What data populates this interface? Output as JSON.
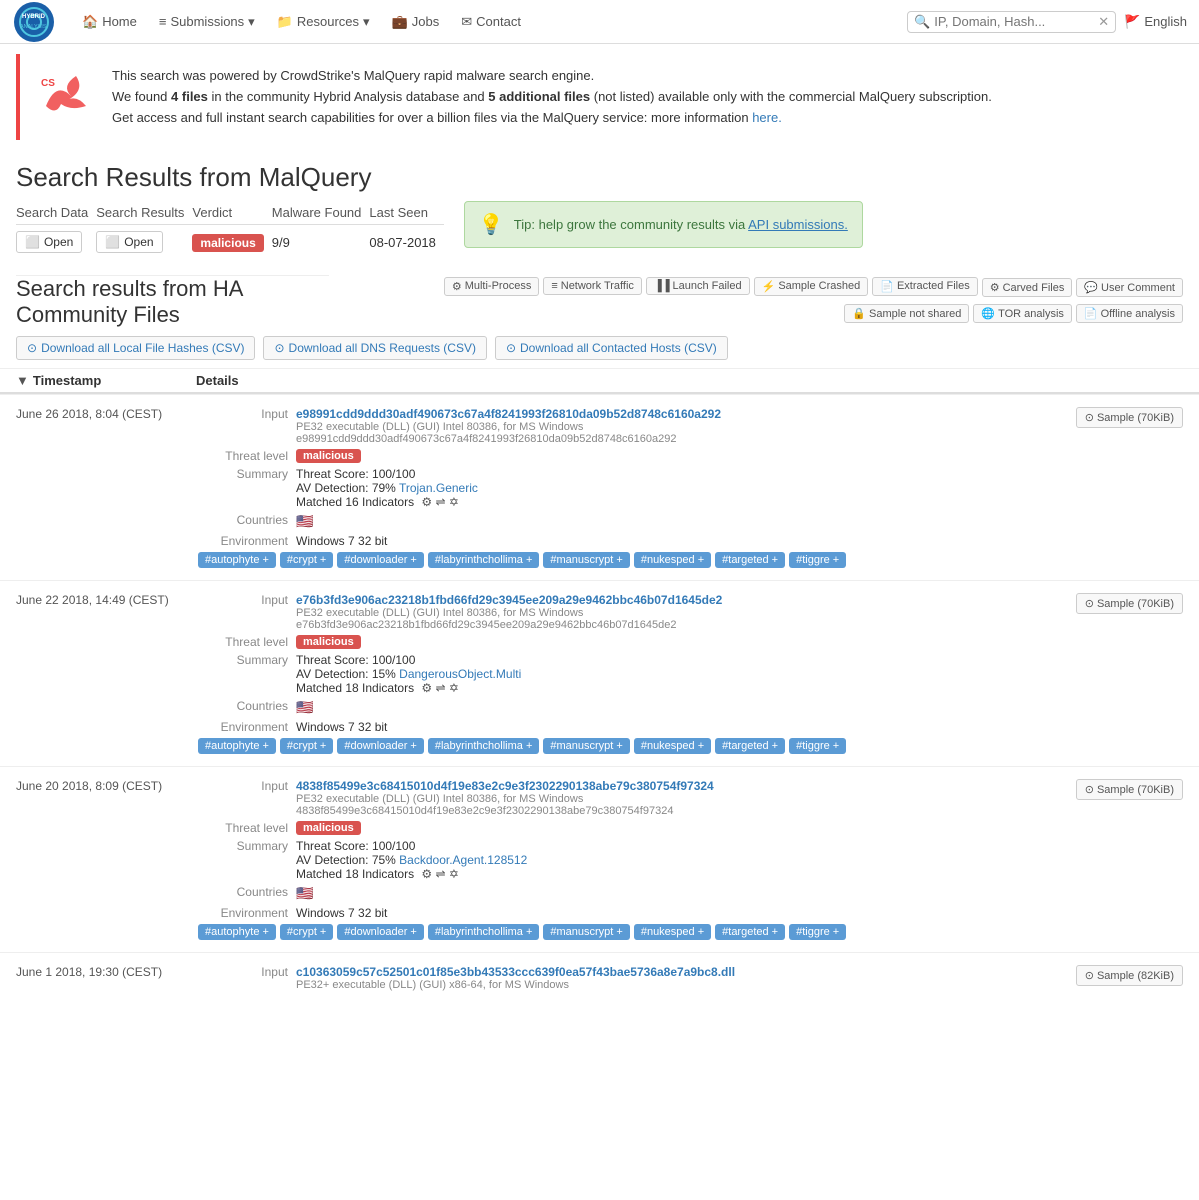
{
  "brand": {
    "name": "HYBRID ANALYSIS",
    "logo_text": "HA"
  },
  "nav": {
    "home": "Home",
    "submissions": "Submissions",
    "resources": "Resources",
    "jobs": "Jobs",
    "contact": "Contact",
    "search_placeholder": "IP, Domain, Hash...",
    "language": "English"
  },
  "banner": {
    "text1": "This search was powered by CrowdStrike's MalQuery rapid malware search engine.",
    "text2_pre": "We found ",
    "text2_bold1": "4 files",
    "text2_mid": " in the community Hybrid Analysis database and ",
    "text2_bold2": "5 additional files",
    "text2_post": " (not listed) available only with the commercial MalQuery subscription.",
    "text3_pre": "Get access and full instant search capabilities for over a billion files via the MalQuery service: more information ",
    "text3_link": "here.",
    "link_url": "#"
  },
  "page_title": "Search Results from MalQuery",
  "search_table": {
    "columns": [
      "Search Data",
      "Search Results",
      "Verdict",
      "Malware Found",
      "Last Seen"
    ],
    "row": {
      "search_data_label": "Open",
      "search_results_label": "Open",
      "verdict": "malicious",
      "malware_found": "9/9",
      "last_seen": "08-07-2018"
    }
  },
  "tip": {
    "text": "Tip: help grow the community results via ",
    "link_text": "API submissions.",
    "link_url": "#"
  },
  "community_title": "Search results from HA Community Files",
  "filter_buttons": [
    {
      "label": "Multi-Process",
      "icon": "⚙"
    },
    {
      "label": "Network Traffic",
      "icon": "≡"
    },
    {
      "label": "Launch Failed",
      "icon": "▐▐"
    },
    {
      "label": "Sample Crashed",
      "icon": "⚡"
    },
    {
      "label": "Extracted Files",
      "icon": "📄"
    },
    {
      "label": "Carved Files",
      "icon": "⚙"
    },
    {
      "label": "User Comment",
      "icon": "💬"
    },
    {
      "label": "Sample not shared",
      "icon": "🔒"
    },
    {
      "label": "TOR analysis",
      "icon": "🌐"
    },
    {
      "label": "Offline analysis",
      "icon": "📄"
    }
  ],
  "download_buttons": [
    {
      "label": "Download all Local File Hashes (CSV)",
      "icon": "⊙"
    },
    {
      "label": "Download all DNS Requests (CSV)",
      "icon": "⊙"
    },
    {
      "label": "Download all Contacted Hosts (CSV)",
      "icon": "⊙"
    }
  ],
  "table_columns": [
    "Timestamp",
    "Details"
  ],
  "results": [
    {
      "timestamp": "June 26 2018, 8:04 (CEST)",
      "input_hash": "e98991cdd9ddd30adf490673c67a4f8241993f26810da09b52d8748c6160a292",
      "input_type": "PE32 executable (DLL) (GUI) Intel 80386, for MS Windows",
      "input_hash2": "e98991cdd9ddd30adf490673c67a4f8241993f26810da09b52d8748c6160a292",
      "threat_level": "malicious",
      "threat_score": "Threat Score: 100/100",
      "av_detection": "AV Detection: 79%",
      "av_name": "Trojan.Generic",
      "matched": "Matched 16 Indicators",
      "countries": "🇺🇸",
      "environment": "Windows 7 32 bit",
      "tags": [
        "#autophyte +",
        "#crypt +",
        "#downloader +",
        "#labyrinthchollima +",
        "#manuscrypt +",
        "#nukesped +",
        "#targeted +",
        "#tiggre +"
      ],
      "sample_label": "Sample (70KiB)"
    },
    {
      "timestamp": "June 22 2018, 14:49 (CEST)",
      "input_hash": "e76b3fd3e906ac23218b1fbd66fd29c3945ee209a29e9462bbc46b07d1645de2",
      "input_type": "PE32 executable (DLL) (GUI) Intel 80386, for MS Windows",
      "input_hash2": "e76b3fd3e906ac23218b1fbd66fd29c3945ee209a29e9462bbc46b07d1645de2",
      "threat_level": "malicious",
      "threat_score": "Threat Score: 100/100",
      "av_detection": "AV Detection: 15%",
      "av_name": "DangerousObject.Multi",
      "matched": "Matched 18 Indicators",
      "countries": "🇺🇸",
      "environment": "Windows 7 32 bit",
      "tags": [
        "#autophyte +",
        "#crypt +",
        "#downloader +",
        "#labyrinthchollima +",
        "#manuscrypt +",
        "#nukesped +",
        "#targeted +",
        "#tiggre +"
      ],
      "sample_label": "Sample (70KiB)"
    },
    {
      "timestamp": "June 20 2018, 8:09 (CEST)",
      "input_hash": "4838f85499e3c68415010d4f19e83e2c9e3f2302290138abe79c380754f97324",
      "input_type": "PE32 executable (DLL) (GUI) Intel 80386, for MS Windows",
      "input_hash2": "4838f85499e3c68415010d4f19e83e2c9e3f2302290138abe79c380754f97324",
      "threat_level": "malicious",
      "threat_score": "Threat Score: 100/100",
      "av_detection": "AV Detection: 75%",
      "av_name": "Backdoor.Agent.128512",
      "matched": "Matched 18 Indicators",
      "countries": "🇺🇸",
      "environment": "Windows 7 32 bit",
      "tags": [
        "#autophyte +",
        "#crypt +",
        "#downloader +",
        "#labyrinthchollima +",
        "#manuscrypt +",
        "#nukesped +",
        "#targeted +",
        "#tiggre +"
      ],
      "sample_label": "Sample (70KiB)"
    },
    {
      "timestamp": "June 1 2018, 19:30 (CEST)",
      "input_hash": "c10363059c57c52501c01f85e3bb43533ccc639f0ea57f43bae5736a8e7a9bc8.dll",
      "input_type": "PE32+ executable (DLL) (GUI) x86-64, for MS Windows",
      "input_hash2": "",
      "threat_level": "",
      "threat_score": "",
      "av_detection": "",
      "av_name": "",
      "matched": "",
      "countries": "",
      "environment": "",
      "tags": [],
      "sample_label": "Sample (82KiB)"
    }
  ]
}
